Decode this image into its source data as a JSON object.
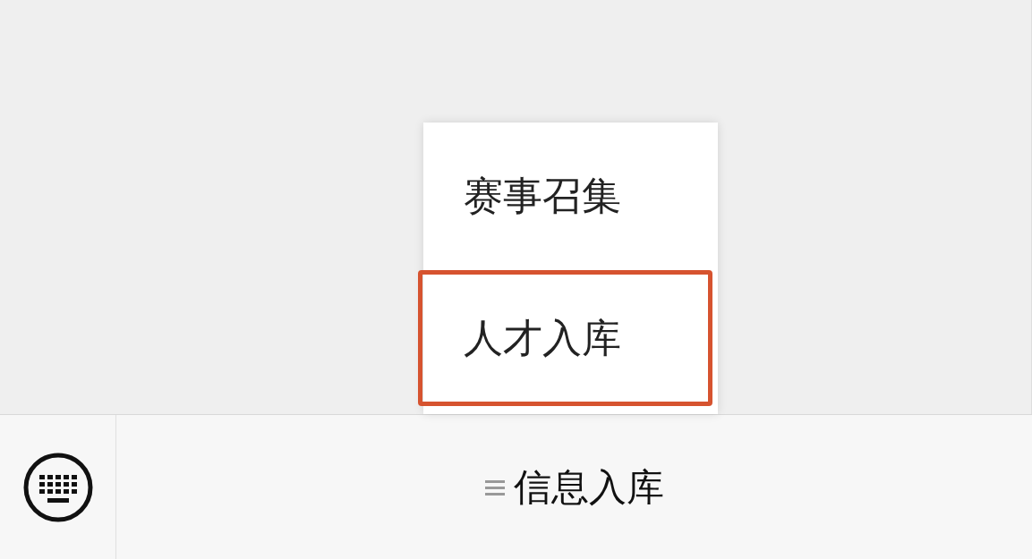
{
  "popup_menu": {
    "items": [
      {
        "label": "赛事召集",
        "highlighted": false
      },
      {
        "label": "人才入库",
        "highlighted": true
      }
    ]
  },
  "menu_bar": {
    "items": [
      {
        "label": "信息入库",
        "has_submenu": true
      }
    ]
  }
}
